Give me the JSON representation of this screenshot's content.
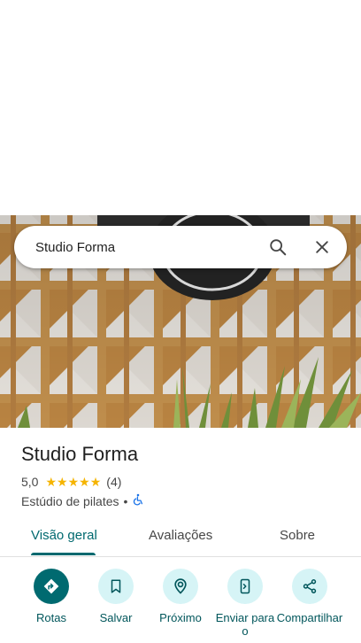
{
  "search": {
    "value": "Studio Forma"
  },
  "place": {
    "name": "Studio Forma",
    "rating": "5,0",
    "stars": 5,
    "review_count": "(4)",
    "category": "Estúdio de pilates",
    "separator": "•",
    "accessibility_icon": "wheelchair-icon"
  },
  "tabs": [
    {
      "label": "Visão geral",
      "active": true
    },
    {
      "label": "Avaliações",
      "active": false
    },
    {
      "label": "Sobre",
      "active": false
    }
  ],
  "actions": [
    {
      "label": "Rotas",
      "icon": "directions-icon"
    },
    {
      "label": "Salvar",
      "icon": "bookmark-icon"
    },
    {
      "label": "Próximo",
      "icon": "nearby-icon"
    },
    {
      "label": "Enviar para o",
      "icon": "send-to-phone-icon"
    },
    {
      "label": "Compartilhar",
      "icon": "share-icon"
    }
  ],
  "colors": {
    "accent": "#00696f",
    "action_bg": "#d6f4f6",
    "star": "#f5b400",
    "photo_wall": "#c99550"
  }
}
